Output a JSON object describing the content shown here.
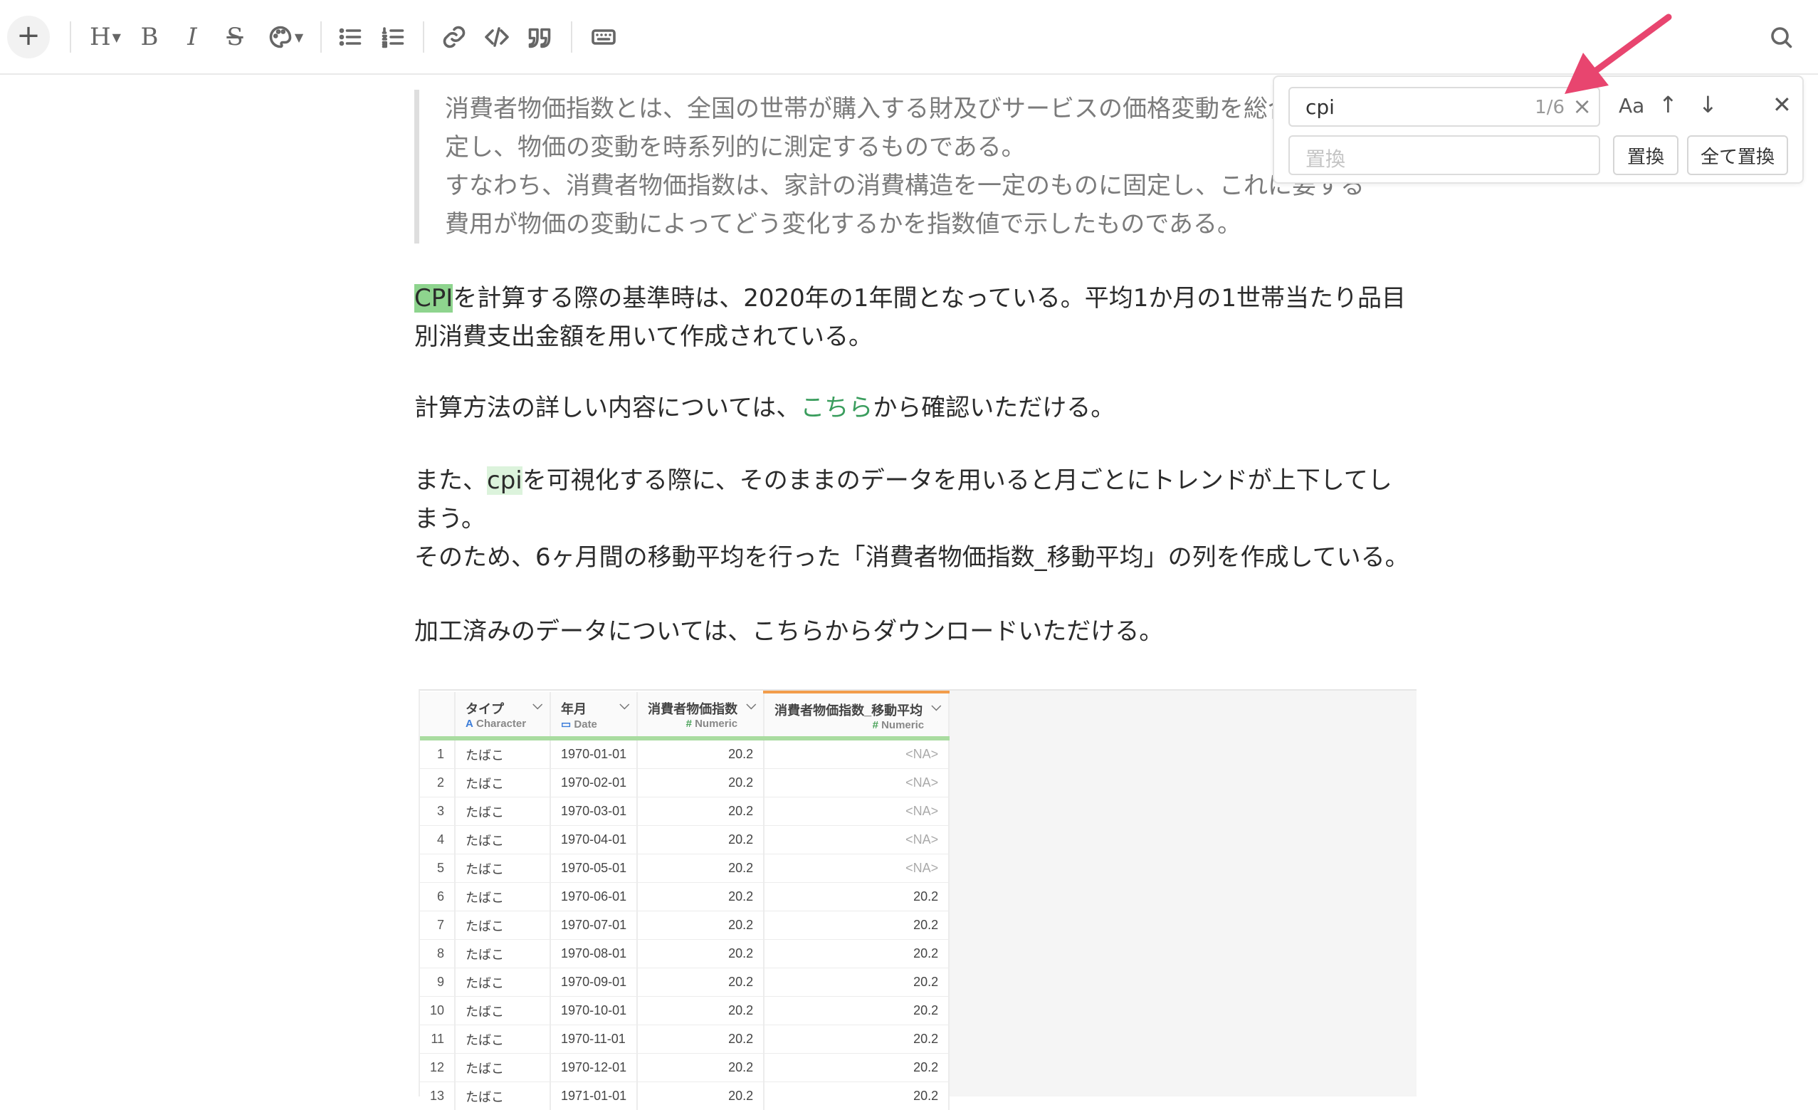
{
  "toolbar": {
    "add": "+",
    "heading": "H",
    "bold": "B",
    "italic": "I",
    "strike": "S"
  },
  "find": {
    "query": "cpi",
    "count": "1/6",
    "replace_placeholder": "置換",
    "case": "Aa",
    "replace_button": "置換",
    "replace_all_button": "全て置換"
  },
  "content": {
    "quote_lines": [
      "消費者物価指数とは、全国の世帯が購入する財及びサービスの価格変動を総合",
      "定し、物価の変動を時系列的に測定するものである。",
      "すなわち、消費者物価指数は、家計の消費構造を一定のものに固定し、これに要する",
      "費用が物価の変動によってどう変化するかを指数値で示したものである。"
    ],
    "p1_hl": "CPI",
    "p1_rest1": "を計算する際の基準時は、2020年の1年間となっている。平均1か月の1世帯当たり品目",
    "p1_rest2": "別消費支出金額を用いて作成されている。",
    "p2_a": "計算方法の詳しい内容については、",
    "p2_link": "こちら",
    "p2_b": "から確認いただける。",
    "p3_a": "また、",
    "p3_hl": "cpi",
    "p3_b": "を可視化する際に、そのままのデータを用いると月ごとにトレンドが上下してし",
    "p3_c": "まう。",
    "p3_d": "そのため、6ヶ月間の移動平均を行った「消費者物価指数_移動平均」の列を作成している。",
    "p4": "加工済みのデータについては、こちらからダウンロードいただける。"
  },
  "table": {
    "columns": [
      {
        "name": "タイプ",
        "type": "Character",
        "type_icon": "A"
      },
      {
        "name": "年月",
        "type": "Date",
        "type_icon": "calendar-icon"
      },
      {
        "name": "消費者物価指数",
        "type": "Numeric",
        "type_icon": "#"
      },
      {
        "name": "消費者物価指数_移動平均",
        "type": "Numeric",
        "type_icon": "#"
      }
    ],
    "rows": [
      [
        "1",
        "たばこ",
        "1970-01-01",
        "20.2",
        "<NA>"
      ],
      [
        "2",
        "たばこ",
        "1970-02-01",
        "20.2",
        "<NA>"
      ],
      [
        "3",
        "たばこ",
        "1970-03-01",
        "20.2",
        "<NA>"
      ],
      [
        "4",
        "たばこ",
        "1970-04-01",
        "20.2",
        "<NA>"
      ],
      [
        "5",
        "たばこ",
        "1970-05-01",
        "20.2",
        "<NA>"
      ],
      [
        "6",
        "たばこ",
        "1970-06-01",
        "20.2",
        "20.2"
      ],
      [
        "7",
        "たばこ",
        "1970-07-01",
        "20.2",
        "20.2"
      ],
      [
        "8",
        "たばこ",
        "1970-08-01",
        "20.2",
        "20.2"
      ],
      [
        "9",
        "たばこ",
        "1970-09-01",
        "20.2",
        "20.2"
      ],
      [
        "10",
        "たばこ",
        "1970-10-01",
        "20.2",
        "20.2"
      ],
      [
        "11",
        "たばこ",
        "1970-11-01",
        "20.2",
        "20.2"
      ],
      [
        "12",
        "たばこ",
        "1970-12-01",
        "20.2",
        "20.2"
      ],
      [
        "13",
        "たばこ",
        "1971-01-01",
        "20.2",
        "20.2"
      ]
    ]
  },
  "colors": {
    "highlight_active": "#8ed48e",
    "highlight": "#dcf3dc",
    "link": "#3a9d5d",
    "annotation_arrow": "#e8456f"
  }
}
